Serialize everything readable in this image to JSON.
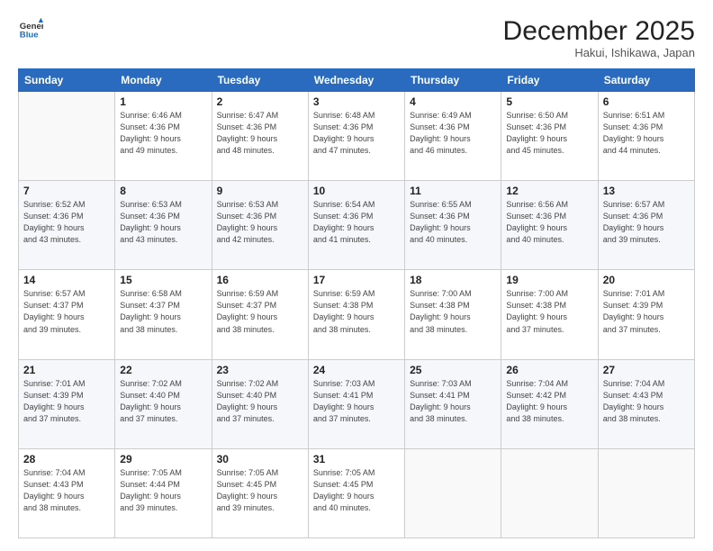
{
  "header": {
    "logo_line1": "General",
    "logo_line2": "Blue",
    "month": "December 2025",
    "location": "Hakui, Ishikawa, Japan"
  },
  "days_of_week": [
    "Sunday",
    "Monday",
    "Tuesday",
    "Wednesday",
    "Thursday",
    "Friday",
    "Saturday"
  ],
  "weeks": [
    {
      "days": [
        {
          "num": "",
          "data": ""
        },
        {
          "num": "1",
          "data": "Sunrise: 6:46 AM\nSunset: 4:36 PM\nDaylight: 9 hours\nand 49 minutes."
        },
        {
          "num": "2",
          "data": "Sunrise: 6:47 AM\nSunset: 4:36 PM\nDaylight: 9 hours\nand 48 minutes."
        },
        {
          "num": "3",
          "data": "Sunrise: 6:48 AM\nSunset: 4:36 PM\nDaylight: 9 hours\nand 47 minutes."
        },
        {
          "num": "4",
          "data": "Sunrise: 6:49 AM\nSunset: 4:36 PM\nDaylight: 9 hours\nand 46 minutes."
        },
        {
          "num": "5",
          "data": "Sunrise: 6:50 AM\nSunset: 4:36 PM\nDaylight: 9 hours\nand 45 minutes."
        },
        {
          "num": "6",
          "data": "Sunrise: 6:51 AM\nSunset: 4:36 PM\nDaylight: 9 hours\nand 44 minutes."
        }
      ]
    },
    {
      "days": [
        {
          "num": "7",
          "data": "Sunrise: 6:52 AM\nSunset: 4:36 PM\nDaylight: 9 hours\nand 43 minutes."
        },
        {
          "num": "8",
          "data": "Sunrise: 6:53 AM\nSunset: 4:36 PM\nDaylight: 9 hours\nand 43 minutes."
        },
        {
          "num": "9",
          "data": "Sunrise: 6:53 AM\nSunset: 4:36 PM\nDaylight: 9 hours\nand 42 minutes."
        },
        {
          "num": "10",
          "data": "Sunrise: 6:54 AM\nSunset: 4:36 PM\nDaylight: 9 hours\nand 41 minutes."
        },
        {
          "num": "11",
          "data": "Sunrise: 6:55 AM\nSunset: 4:36 PM\nDaylight: 9 hours\nand 40 minutes."
        },
        {
          "num": "12",
          "data": "Sunrise: 6:56 AM\nSunset: 4:36 PM\nDaylight: 9 hours\nand 40 minutes."
        },
        {
          "num": "13",
          "data": "Sunrise: 6:57 AM\nSunset: 4:36 PM\nDaylight: 9 hours\nand 39 minutes."
        }
      ]
    },
    {
      "days": [
        {
          "num": "14",
          "data": "Sunrise: 6:57 AM\nSunset: 4:37 PM\nDaylight: 9 hours\nand 39 minutes."
        },
        {
          "num": "15",
          "data": "Sunrise: 6:58 AM\nSunset: 4:37 PM\nDaylight: 9 hours\nand 38 minutes."
        },
        {
          "num": "16",
          "data": "Sunrise: 6:59 AM\nSunset: 4:37 PM\nDaylight: 9 hours\nand 38 minutes."
        },
        {
          "num": "17",
          "data": "Sunrise: 6:59 AM\nSunset: 4:38 PM\nDaylight: 9 hours\nand 38 minutes."
        },
        {
          "num": "18",
          "data": "Sunrise: 7:00 AM\nSunset: 4:38 PM\nDaylight: 9 hours\nand 38 minutes."
        },
        {
          "num": "19",
          "data": "Sunrise: 7:00 AM\nSunset: 4:38 PM\nDaylight: 9 hours\nand 37 minutes."
        },
        {
          "num": "20",
          "data": "Sunrise: 7:01 AM\nSunset: 4:39 PM\nDaylight: 9 hours\nand 37 minutes."
        }
      ]
    },
    {
      "days": [
        {
          "num": "21",
          "data": "Sunrise: 7:01 AM\nSunset: 4:39 PM\nDaylight: 9 hours\nand 37 minutes."
        },
        {
          "num": "22",
          "data": "Sunrise: 7:02 AM\nSunset: 4:40 PM\nDaylight: 9 hours\nand 37 minutes."
        },
        {
          "num": "23",
          "data": "Sunrise: 7:02 AM\nSunset: 4:40 PM\nDaylight: 9 hours\nand 37 minutes."
        },
        {
          "num": "24",
          "data": "Sunrise: 7:03 AM\nSunset: 4:41 PM\nDaylight: 9 hours\nand 37 minutes."
        },
        {
          "num": "25",
          "data": "Sunrise: 7:03 AM\nSunset: 4:41 PM\nDaylight: 9 hours\nand 38 minutes."
        },
        {
          "num": "26",
          "data": "Sunrise: 7:04 AM\nSunset: 4:42 PM\nDaylight: 9 hours\nand 38 minutes."
        },
        {
          "num": "27",
          "data": "Sunrise: 7:04 AM\nSunset: 4:43 PM\nDaylight: 9 hours\nand 38 minutes."
        }
      ]
    },
    {
      "days": [
        {
          "num": "28",
          "data": "Sunrise: 7:04 AM\nSunset: 4:43 PM\nDaylight: 9 hours\nand 38 minutes."
        },
        {
          "num": "29",
          "data": "Sunrise: 7:05 AM\nSunset: 4:44 PM\nDaylight: 9 hours\nand 39 minutes."
        },
        {
          "num": "30",
          "data": "Sunrise: 7:05 AM\nSunset: 4:45 PM\nDaylight: 9 hours\nand 39 minutes."
        },
        {
          "num": "31",
          "data": "Sunrise: 7:05 AM\nSunset: 4:45 PM\nDaylight: 9 hours\nand 40 minutes."
        },
        {
          "num": "",
          "data": ""
        },
        {
          "num": "",
          "data": ""
        },
        {
          "num": "",
          "data": ""
        }
      ]
    }
  ]
}
